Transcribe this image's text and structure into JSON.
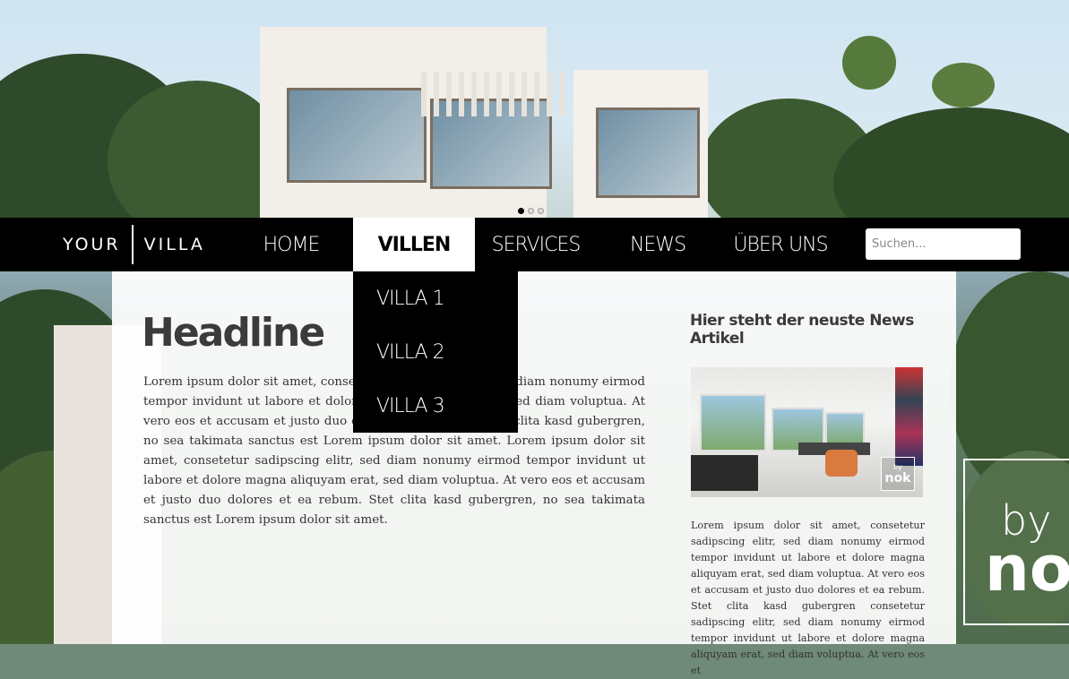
{
  "logo": {
    "left": "YOUR",
    "right": "VILLA"
  },
  "nav": {
    "items": [
      {
        "label": "HOME"
      },
      {
        "label": "VILLEN"
      },
      {
        "label": "SERVICES"
      },
      {
        "label": "NEWS"
      },
      {
        "label": "ÜBER UNS"
      }
    ],
    "active": "VILLEN"
  },
  "search": {
    "placeholder": "Suchen..."
  },
  "dropdown": {
    "items": [
      "VILLA 1",
      "VILLA 2",
      "VILLA 3"
    ]
  },
  "slider": {
    "dots": 3,
    "active_index": 0
  },
  "main": {
    "headline": "Headline",
    "body": "Lorem ipsum dolor sit amet, consetetur sadipscing elitr, sed diam nonumy eirmod tempor invidunt ut labore et dolore magna aliquyam erat, sed diam voluptua. At vero eos et accusam et justo duo dolores et ea rebum. Stet clita kasd gubergren, no sea takimata sanctus est Lorem ipsum dolor sit amet. Lorem ipsum dolor sit amet, consetetur sadipscing elitr, sed diam nonumy eirmod tempor invidunt ut labore et dolore magna aliquyam erat, sed diam voluptua. At vero eos et accusam et justo duo dolores et ea rebum. Stet clita kasd gubergren, no sea takimata sanctus est Lorem ipsum dolor sit amet."
  },
  "news": {
    "title": "Hier steht der neuste News Artikel",
    "badge": {
      "by": "by",
      "brand": "nok"
    },
    "body": "Lorem ipsum dolor sit amet, consetetur sadipscing elitr, sed diam nonumy eirmod tempor invidunt ut labore et dolore magna aliquyam erat, sed diam voluptua. At vero eos et accusam et justo duo dolores et ea rebum. Stet clita kasd gubergren consetetur sadipscing elitr, sed diam nonumy eirmod tempor invidunt ut labore et dolore magna aliquyam erat, sed diam voluptua. At vero eos et"
  },
  "brand_sign": {
    "by": "by",
    "brand": "no"
  },
  "colors": {
    "nav_bg": "#000000",
    "nav_text": "#ffffff",
    "active_bg": "#ffffff",
    "active_text": "#000000",
    "headline": "#3b3b3b"
  }
}
